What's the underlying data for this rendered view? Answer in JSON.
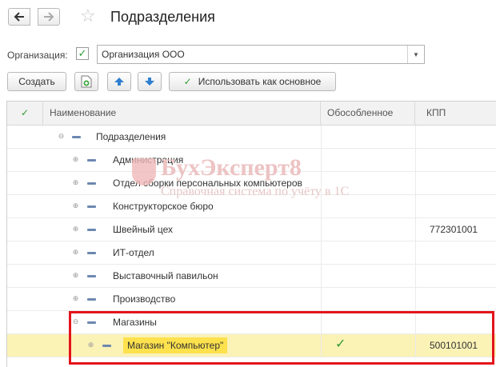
{
  "header": {
    "title": "Подразделения",
    "back_icon": "arrow-left-icon",
    "forward_icon": "arrow-right-icon",
    "favorite_icon": "star-icon"
  },
  "org": {
    "label": "Организация:",
    "checked": true,
    "value": "Организация ООО"
  },
  "toolbar": {
    "create_label": "Создать",
    "set_main_label": "Использовать как основное"
  },
  "table": {
    "columns": {
      "name": "Наименование",
      "separate": "Обособленное",
      "kpp": "КПП"
    },
    "rows": [
      {
        "name": "Подразделения",
        "kpp": "",
        "separate": false
      },
      {
        "name": "Администрация",
        "kpp": "",
        "separate": false
      },
      {
        "name": "Отдел сборки персональных компьютеров",
        "kpp": "",
        "separate": false
      },
      {
        "name": "Конструкторское бюро",
        "kpp": "",
        "separate": false
      },
      {
        "name": "Швейный цех",
        "kpp": "772301001",
        "separate": false
      },
      {
        "name": "ИТ-отдел",
        "kpp": "",
        "separate": false
      },
      {
        "name": "Выставочный павильон",
        "kpp": "",
        "separate": false
      },
      {
        "name": "Производство",
        "kpp": "",
        "separate": false
      },
      {
        "name": "Магазины",
        "kpp": "",
        "separate": false
      },
      {
        "name": "Магазин \"Компьютер\"",
        "kpp": "500101001",
        "separate": true
      }
    ]
  },
  "watermark": {
    "title": "БухЭксперт8",
    "subtitle": "Справочная система по учёту в 1С"
  },
  "colors": {
    "accent_green": "#2f9a33",
    "selection": "#fbf2b6",
    "highlight": "#fde14d",
    "frame_red": "#e3141b"
  }
}
